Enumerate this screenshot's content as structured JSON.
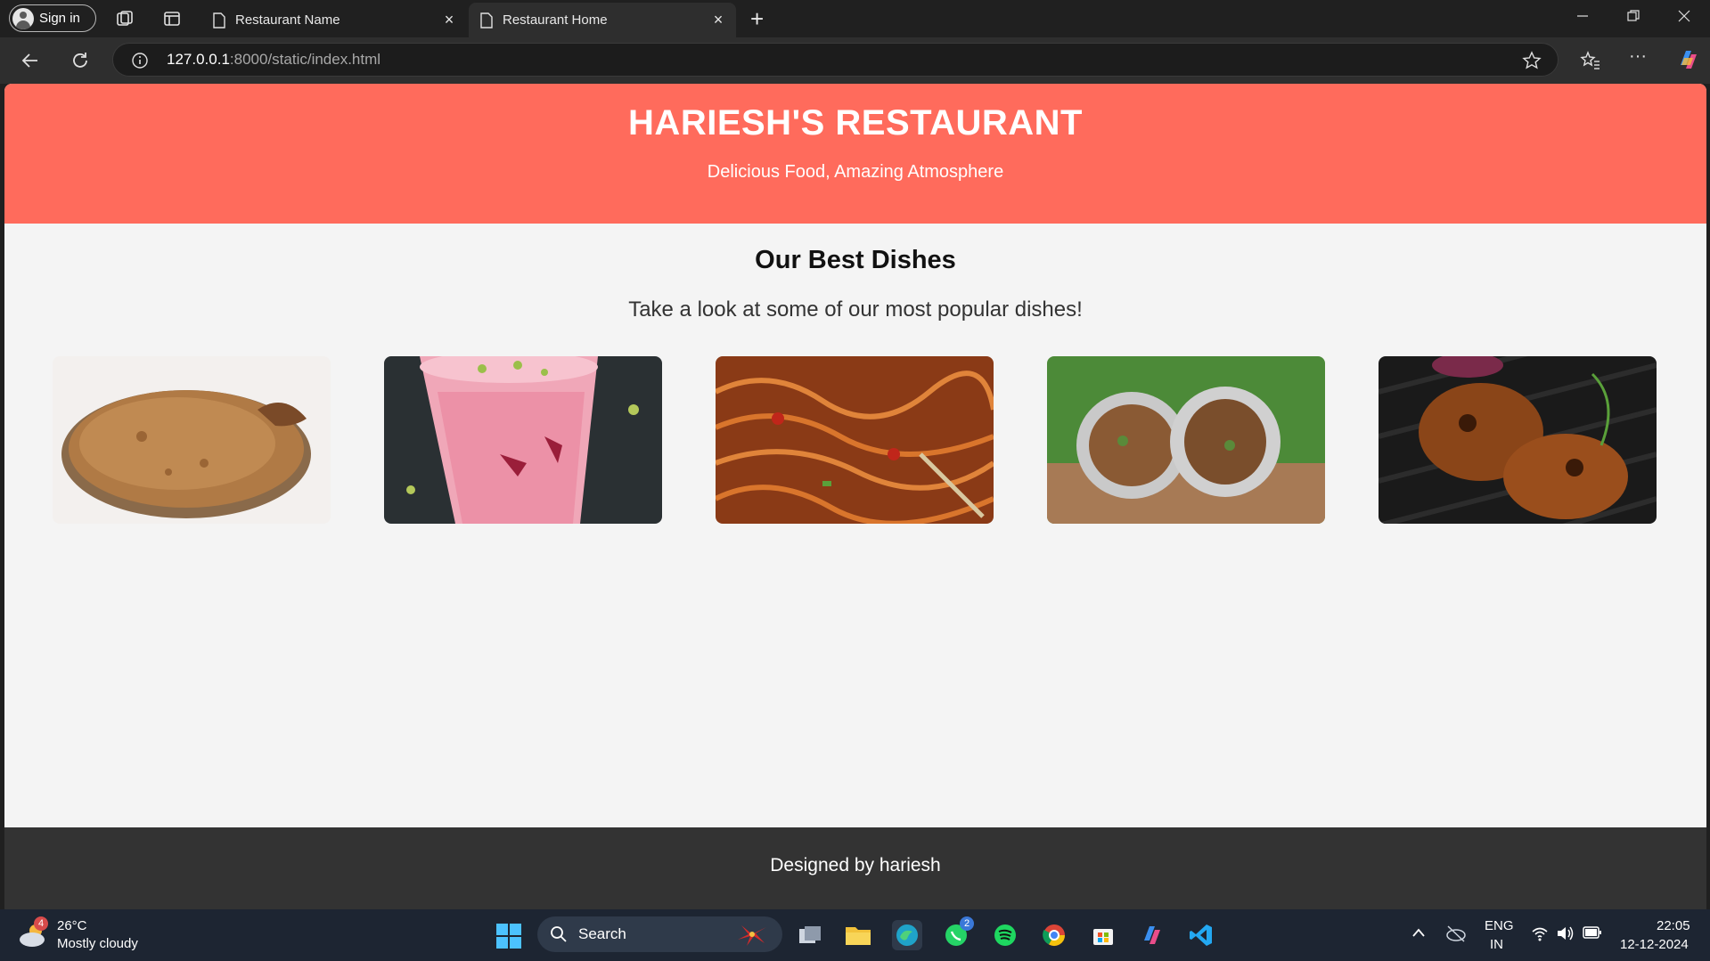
{
  "browser": {
    "signin_label": "Sign in",
    "tabs": [
      {
        "title": "Restaurant Name",
        "close": "×"
      },
      {
        "title": "Restaurant Home",
        "close": "×"
      }
    ],
    "new_tab": "+",
    "address": {
      "host": "127.0.0.1",
      "path": ":8000/static/index.html"
    },
    "more_menu": "···"
  },
  "page": {
    "header": {
      "title": "HARIESH'S RESTAURANT",
      "tagline": "Delicious Food, Amazing Atmosphere"
    },
    "dishes": {
      "heading": "Our Best Dishes",
      "subheading": "Take a look at some of our most popular dishes!",
      "items": [
        "biryani-dish-image",
        "falooda-dish-image",
        "noodles-dish-image",
        "burrito-dish-image",
        "grilled-chicken-dish-image"
      ]
    },
    "footer": {
      "text": "Designed by hariesh"
    }
  },
  "taskbar": {
    "weather": {
      "temp": "26°C",
      "desc": "Mostly cloudy",
      "badge": "4"
    },
    "search_label": "Search",
    "whatsapp_badge": "2",
    "lang_top": "ENG",
    "lang_bottom": "IN",
    "time": "22:05",
    "date": "12-12-2024"
  },
  "colors": {
    "hero": "#ff6b5c",
    "footer": "#333333",
    "page_bg": "#f4f4f4"
  }
}
